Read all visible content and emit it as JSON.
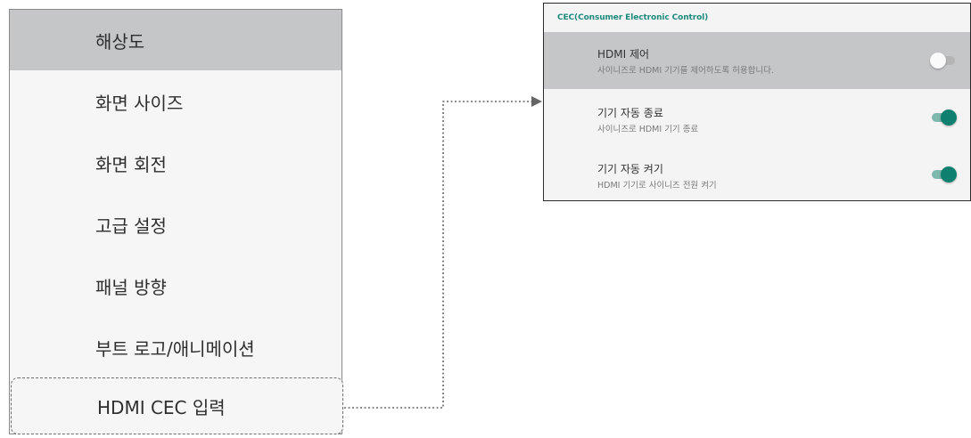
{
  "menu": {
    "items": [
      {
        "label": "해상도"
      },
      {
        "label": "화면 사이즈"
      },
      {
        "label": "화면 회전"
      },
      {
        "label": "고급 설정"
      },
      {
        "label": "패널 방향"
      },
      {
        "label": "부트 로고/애니메이션"
      },
      {
        "label": "HDMI CEC 입력"
      }
    ]
  },
  "cec": {
    "header": "CEC(Consumer Electronic Control)",
    "rows": [
      {
        "title": "HDMI 제어",
        "subtitle": "사이니즈로 HDMI 기기를 제어하도록 허용합니다.",
        "enabled": false
      },
      {
        "title": "기기 자동 종료",
        "subtitle": "사이니즈로 HDMI 기기 종료",
        "enabled": true
      },
      {
        "title": "기기 자동 켜기",
        "subtitle": "HDMI 기기로 사이니즈 전원 켜기",
        "enabled": true
      }
    ]
  },
  "colors": {
    "accent": "#1f8a7c",
    "toggle_on": "#0f8070",
    "selected_bg": "#c4c6c8"
  }
}
